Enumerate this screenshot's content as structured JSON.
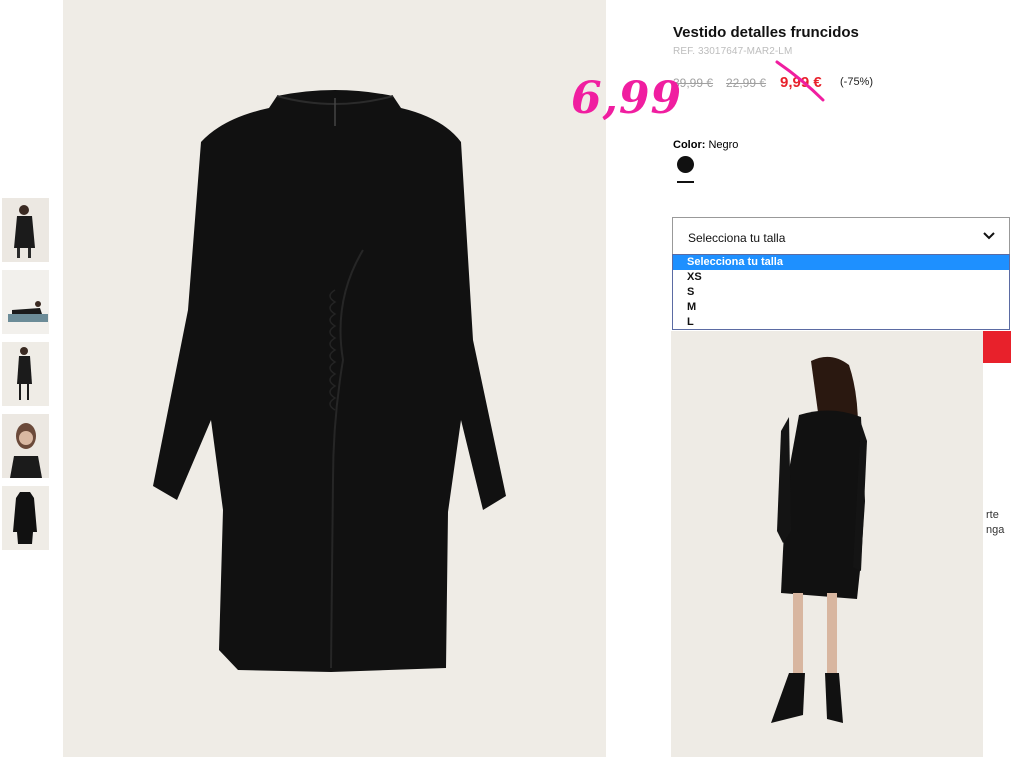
{
  "product": {
    "title": "Vestido detalles fruncidos",
    "ref": "REF. 33017647-MAR2-LM",
    "old_price_1": "39,99 €",
    "old_price_2": "22,99 €",
    "sale_price": "9,99 €",
    "discount": "(-75%)",
    "handwritten_price": "6,99"
  },
  "color": {
    "label": "Color:",
    "value": "Negro",
    "swatch_hex": "#111111"
  },
  "size_select": {
    "selected": "Selecciona tu talla",
    "options": [
      "Selecciona tu talla",
      "XS",
      "S",
      "M",
      "L"
    ]
  },
  "side_text": {
    "line1": "rte",
    "line2": "nga"
  },
  "colors": {
    "accent_red": "#e8212b",
    "annotation_pink": "#f01ea0",
    "dropdown_highlight": "#1e90ff"
  },
  "thumbnails": [
    "front-thumbnail",
    "lying-thumbnail",
    "full-body-thumbnail",
    "portrait-thumbnail",
    "dress-thumbnail"
  ]
}
